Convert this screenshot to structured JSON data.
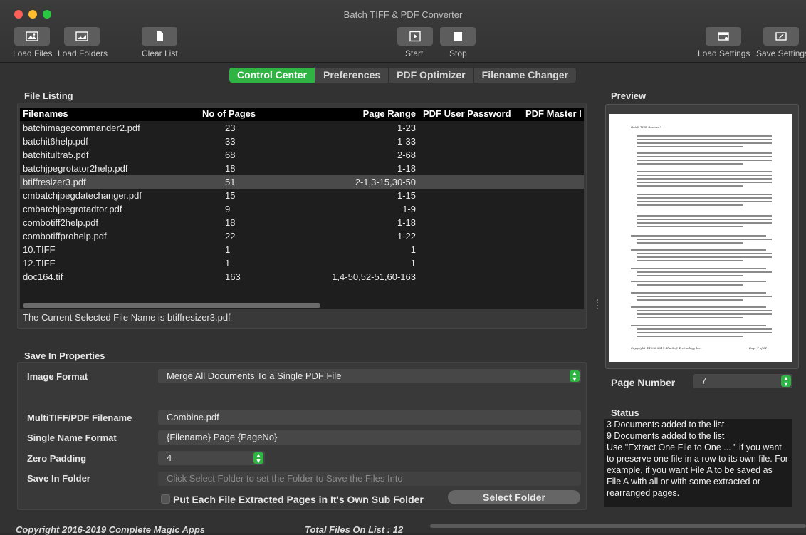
{
  "window": {
    "title": "Batch TIFF & PDF Converter"
  },
  "toolbar": {
    "load_files": "Load Files",
    "load_folders": "Load Folders",
    "clear_list": "Clear List",
    "start": "Start",
    "stop": "Stop",
    "load_settings": "Load Settings",
    "save_settings": "Save Settings"
  },
  "tabs": [
    "Control Center",
    "Preferences",
    "PDF Optimizer",
    "Filename Changer"
  ],
  "file_listing": {
    "title": "File Listing",
    "columns": [
      "Filenames",
      "No of Pages",
      "Page Range",
      "PDF User Password",
      "PDF Master I"
    ],
    "rows": [
      [
        "batchimagecommander2.pdf",
        "23",
        "1-23"
      ],
      [
        "batchit6help.pdf",
        "33",
        "1-33"
      ],
      [
        "batchitultra5.pdf",
        "68",
        "2-68"
      ],
      [
        "batchjpegrotator2help.pdf",
        "18",
        "1-18"
      ],
      [
        "btiffresizer3.pdf",
        "51",
        "2-1,3-15,30-50"
      ],
      [
        "cmbatchjpegdatechanger.pdf",
        "15",
        "1-15"
      ],
      [
        "cmbatchjpegrotadtor.pdf",
        "9",
        "1-9"
      ],
      [
        "combotiff2help.pdf",
        "18",
        "1-18"
      ],
      [
        "combotiffprohelp.pdf",
        "22",
        "1-22"
      ],
      [
        "10.TIFF",
        "1",
        "1"
      ],
      [
        "12.TIFF",
        "1",
        "1"
      ],
      [
        "doc164.tif",
        "163",
        "1,4-50,52-51,60-163"
      ]
    ],
    "selected_index": 4,
    "current_selected": "The Current Selected File Name is btiffresizer3.pdf"
  },
  "save_props": {
    "title": "Save In Properties",
    "image_format_label": "Image Format",
    "image_format_value": "Merge All Documents To a Single PDF File",
    "multitiff_label": "MultiTIFF/PDF Filename",
    "multitiff_value": "Combine.pdf",
    "single_name_label": "Single Name Format",
    "single_name_value": "{Filename} Page {PageNo}",
    "zero_padding_label": "Zero Padding",
    "zero_padding_value": "4",
    "save_folder_label": "Save In Folder",
    "save_folder_placeholder": "Click Select Folder to set the Folder to Save the Files Into",
    "subfolder_checkbox": "Put Each File Extracted Pages in It's Own Sub Folder",
    "select_folder_button": "Select Folder"
  },
  "preview": {
    "title": "Preview",
    "page_number_label": "Page Number",
    "page_number_value": "7",
    "page_header": "Batch TIFF Resizer 3",
    "page_footer_left": "Copyright ©1998-2017 BlueSoft Technology Inc.",
    "page_footer_right": "Page 7 of 51"
  },
  "status": {
    "title": "Status",
    "lines": [
      "3 Documents added to the list",
      "9 Documents added to the list",
      "Use \"Extract One File to One ... \" if you want to preserve one file in a row to its own file. For example, if you want File A to be saved as File A with all or with some extracted or rearranged pages."
    ]
  },
  "footer": {
    "copyright": "Copyright 2016-2019 Complete Magic Apps",
    "total_files": "Total Files On List : 12"
  },
  "colors": {
    "accent": "#2fb343",
    "background": "#323232",
    "table_bg": "#1e1e1e"
  }
}
